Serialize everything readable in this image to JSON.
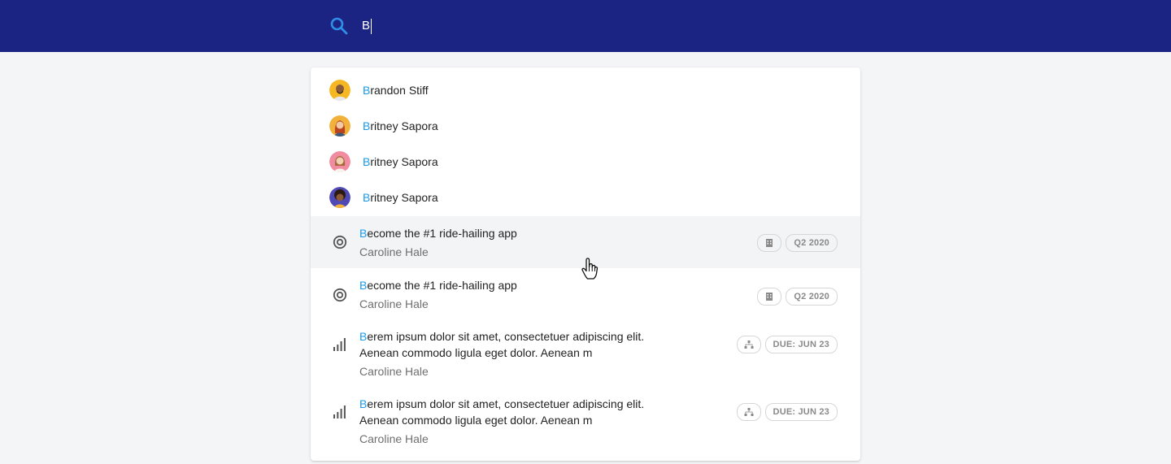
{
  "search": {
    "query_highlight": "B",
    "query": "B"
  },
  "people": [
    {
      "highlight": "B",
      "rest": "randon Stiff",
      "avatar": "avatar-man-bald-beard"
    },
    {
      "highlight": "B",
      "rest": "ritney Sapora",
      "avatar": "avatar-woman-red-hair"
    },
    {
      "highlight": "B",
      "rest": "ritney Sapora",
      "avatar": "avatar-woman-pink-bg"
    },
    {
      "highlight": "B",
      "rest": "ritney Sapora",
      "avatar": "avatar-woman-curly-hair"
    }
  ],
  "results": [
    {
      "icon": "goal-target-icon",
      "highlight": "B",
      "title_rest": "ecome the #1 ride-hailing app",
      "title_line2": "",
      "owner": "Caroline Hale",
      "chip_icon": "building-icon",
      "chip_label": "Q2 2020",
      "hovered": true
    },
    {
      "icon": "goal-target-icon",
      "highlight": "B",
      "title_rest": "ecome the #1 ride-hailing app",
      "title_line2": "",
      "owner": "Caroline Hale",
      "chip_icon": "building-icon",
      "chip_label": "Q2 2020",
      "hovered": false
    },
    {
      "icon": "signal-bars-icon",
      "highlight": "B",
      "title_rest": "erem ipsum dolor sit amet, consectetuer adipiscing elit.",
      "title_line2": "Aenean commodo ligula eget dolor. Aenean m",
      "owner": "Caroline Hale",
      "chip_icon": "org-chart-icon",
      "chip_label": "DUE: JUN 23",
      "hovered": false
    },
    {
      "icon": "signal-bars-icon",
      "highlight": "B",
      "title_rest": "erem ipsum dolor sit amet, consectetuer adipiscing elit.",
      "title_line2": "Aenean commodo ligula eget dolor. Aenean m",
      "owner": "Caroline Hale",
      "chip_icon": "org-chart-icon",
      "chip_label": "DUE: JUN 23",
      "hovered": false
    }
  ],
  "colors": {
    "topbar": "#1b2383",
    "highlight": "#1a9be8",
    "search_icon": "#2f8fe6"
  }
}
